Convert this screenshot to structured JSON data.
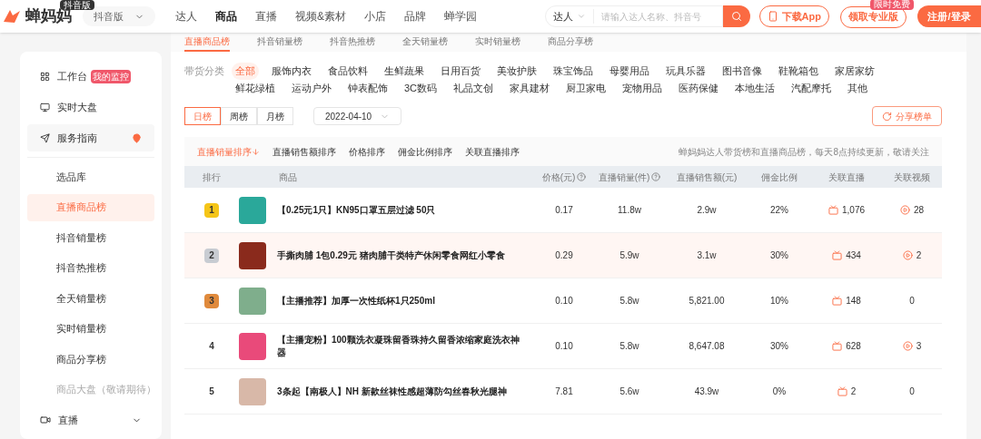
{
  "header": {
    "logo_text": "蝉妈妈",
    "logo_badge": "抖音版",
    "platform_select": "抖音版",
    "nav": [
      {
        "label": "达人",
        "selected": false
      },
      {
        "label": "商品",
        "selected": true
      },
      {
        "label": "直播",
        "selected": false
      },
      {
        "label": "视频&素材",
        "selected": false
      },
      {
        "label": "小店",
        "selected": false
      },
      {
        "label": "品牌",
        "selected": false
      },
      {
        "label": "蝉学园",
        "selected": false
      }
    ],
    "search": {
      "scope": "达人",
      "placeholder": "请输入达人名称、抖音号"
    },
    "download_button": "下载App",
    "pro_button": "领取专业版",
    "pro_badge": "限时免费",
    "login_button": "注册/登录"
  },
  "sub_tabs": [
    {
      "label": "直播商品榜",
      "selected": true
    },
    {
      "label": "抖音销量榜",
      "selected": false
    },
    {
      "label": "抖音热推榜",
      "selected": false
    },
    {
      "label": "全天销量榜",
      "selected": false
    },
    {
      "label": "实时销量榜",
      "selected": false
    },
    {
      "label": "商品分享榜",
      "selected": false
    }
  ],
  "sidebar": {
    "top_items": [
      {
        "label": "工作台",
        "badge": "我的监控",
        "pin": false
      },
      {
        "label": "实时大盘",
        "pin": false
      },
      {
        "label": "服务指南",
        "pin": true
      }
    ],
    "items": [
      {
        "label": "选品库",
        "selected": false,
        "disabled": false
      },
      {
        "label": "直播商品榜",
        "selected": true,
        "disabled": false
      },
      {
        "label": "抖音销量榜",
        "selected": false,
        "disabled": false
      },
      {
        "label": "抖音热推榜",
        "selected": false,
        "disabled": false
      },
      {
        "label": "全天销量榜",
        "selected": false,
        "disabled": false
      },
      {
        "label": "实时销量榜",
        "selected": false,
        "disabled": false
      },
      {
        "label": "商品分享榜",
        "selected": false,
        "disabled": false
      },
      {
        "label": "商品大盘（敬请期待）",
        "selected": false,
        "disabled": true
      }
    ],
    "bottom_item": {
      "label": "直播",
      "expanded": false
    }
  },
  "filters": {
    "label": "带货分类",
    "categories": [
      {
        "label": "全部",
        "selected": true
      },
      {
        "label": "服饰内衣",
        "selected": false
      },
      {
        "label": "食品饮料",
        "selected": false
      },
      {
        "label": "生鲜蔬果",
        "selected": false
      },
      {
        "label": "日用百货",
        "selected": false
      },
      {
        "label": "美妆护肤",
        "selected": false
      },
      {
        "label": "珠宝饰品",
        "selected": false
      },
      {
        "label": "母婴用品",
        "selected": false
      },
      {
        "label": "玩具乐器",
        "selected": false
      },
      {
        "label": "图书音像",
        "selected": false
      },
      {
        "label": "鞋靴箱包",
        "selected": false
      },
      {
        "label": "家居家纺",
        "selected": false
      },
      {
        "label": "鲜花绿植",
        "selected": false
      },
      {
        "label": "运动户外",
        "selected": false
      },
      {
        "label": "钟表配饰",
        "selected": false
      },
      {
        "label": "3C数码",
        "selected": false
      },
      {
        "label": "礼品文创",
        "selected": false
      },
      {
        "label": "家具建材",
        "selected": false
      },
      {
        "label": "厨卫家电",
        "selected": false
      },
      {
        "label": "宠物用品",
        "selected": false
      },
      {
        "label": "医药保健",
        "selected": false
      },
      {
        "label": "本地生活",
        "selected": false
      },
      {
        "label": "汽配摩托",
        "selected": false
      },
      {
        "label": "其他",
        "selected": false
      }
    ]
  },
  "periods": [
    {
      "label": "日榜",
      "selected": true
    },
    {
      "label": "周榜",
      "selected": false
    },
    {
      "label": "月榜",
      "selected": false
    }
  ],
  "date": "2022-04-10",
  "share_button": "分享榜单",
  "sorts": [
    {
      "label": "直播销量排序",
      "selected": true
    },
    {
      "label": "直播销售额排序",
      "selected": false
    },
    {
      "label": "价格排序",
      "selected": false
    },
    {
      "label": "佣金比例排序",
      "selected": false
    },
    {
      "label": "关联直播排序",
      "selected": false
    }
  ],
  "notice": "蝉妈妈达人带货榜和直播商品榜，每天8点持续更新，敬请关注",
  "table": {
    "columns": [
      {
        "label": "排行",
        "help": false
      },
      {
        "label": "商品",
        "help": false
      },
      {
        "label": "价格(元)",
        "help": true
      },
      {
        "label": "直播销量(件)",
        "help": true
      },
      {
        "label": "直播销售额(元)",
        "help": false
      },
      {
        "label": "佣金比例",
        "help": false
      },
      {
        "label": "关联直播",
        "help": false
      },
      {
        "label": "关联视频",
        "help": false
      }
    ],
    "rows": [
      {
        "rank": "1",
        "kind": "medal",
        "color": "#f5c518",
        "selected": false,
        "title": "【0.25元1只】KN95口罩五层过滤 50只",
        "price": "0.17",
        "sales": "11.8w",
        "revenue": "2.9w",
        "commission": "22%",
        "lives": "1,076",
        "videos": "28",
        "video_icon": true
      },
      {
        "rank": "2",
        "kind": "medal",
        "color": "#c8ccd2",
        "selected": true,
        "title": "手撕肉脯 1包0.29元 猪肉脯干类特产休闲零食网红小零食",
        "price": "0.29",
        "sales": "5.9w",
        "revenue": "3.1w",
        "commission": "30%",
        "lives": "434",
        "videos": "2",
        "video_icon": true
      },
      {
        "rank": "3",
        "kind": "medal",
        "color": "#e08a3c",
        "selected": false,
        "title": "【主播推荐】加厚一次性纸杯1只250ml",
        "price": "0.10",
        "sales": "5.8w",
        "revenue": "5,821.00",
        "commission": "10%",
        "lives": "148",
        "videos": "0",
        "video_icon": false
      },
      {
        "rank": "4",
        "kind": "plain",
        "selected": false,
        "title": "【主播宠粉】100颗洗衣凝珠留香珠持久留香浓缩家庭洗衣神器",
        "price": "0.10",
        "sales": "5.8w",
        "revenue": "8,647.08",
        "commission": "30%",
        "lives": "628",
        "videos": "3",
        "video_icon": true
      },
      {
        "rank": "5",
        "kind": "plain",
        "selected": false,
        "title": "3条起【南极人】NH 新款丝袜性感超薄防勾丝春秋光腿神",
        "price": "7.81",
        "sales": "5.6w",
        "revenue": "43.9w",
        "commission": "0%",
        "lives": "2",
        "videos": "0",
        "video_icon": false
      }
    ]
  }
}
